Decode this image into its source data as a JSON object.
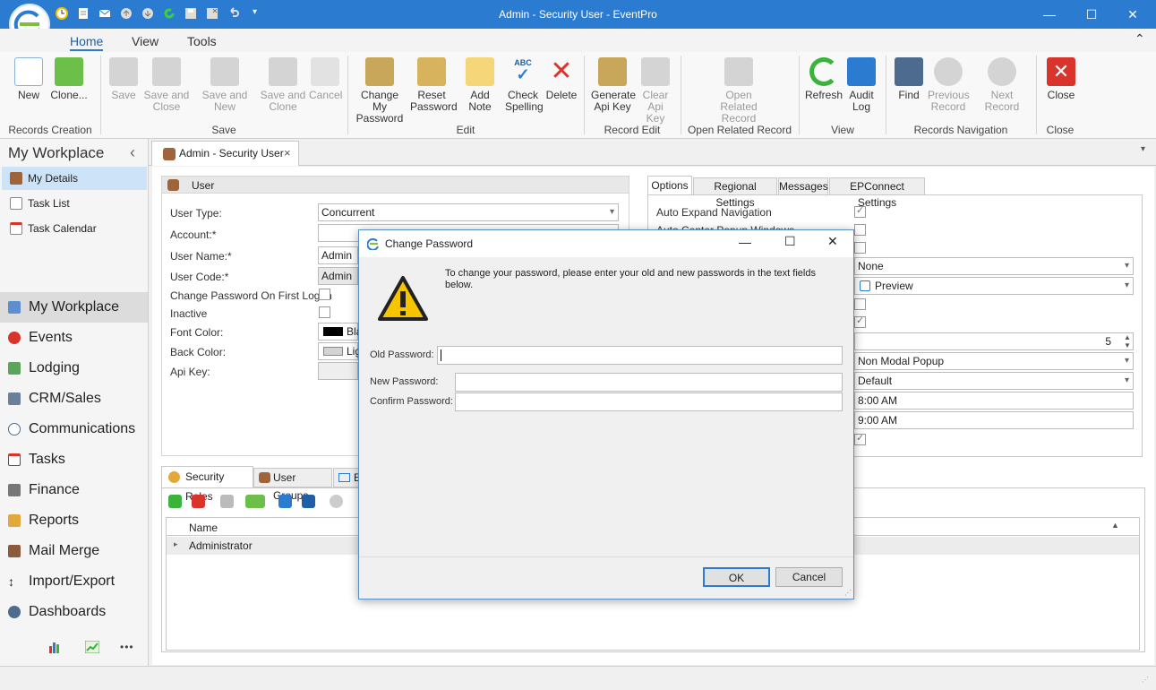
{
  "window": {
    "title": "Admin - Security User - EventPro",
    "minimize": "—",
    "maximize": "☐",
    "close": "✕"
  },
  "ribbon_tabs": [
    "Home",
    "View",
    "Tools"
  ],
  "ribbon": {
    "groups": [
      "Records Creation",
      "Save",
      "Edit",
      "Record Edit",
      "Open Related Record",
      "View",
      "Records Navigation",
      "Close"
    ],
    "buttons": {
      "new": "New",
      "clone": "Clone...",
      "save": "Save",
      "save_close_1": "Save and",
      "save_close_2": "Close",
      "save_new": "Save and New",
      "save_clone_1": "Save and",
      "save_clone_2": "Clone",
      "cancel": "Cancel",
      "change_pw_1": "Change My",
      "change_pw_2": "Password",
      "reset_pw_1": "Reset",
      "reset_pw_2": "Password",
      "add_note": "Add Note",
      "check_1": "Check",
      "check_2": "Spelling",
      "check_abc": "ABC",
      "delete": "Delete",
      "gen_api_1": "Generate",
      "gen_api_2": "Api Key",
      "clear_api_1": "Clear",
      "clear_api_2": "Api Key",
      "open_rel_1": "Open Related",
      "open_rel_2": "Record",
      "refresh": "Refresh",
      "audit_1": "Audit",
      "audit_2": "Log",
      "find": "Find",
      "prev_1": "Previous",
      "prev_2": "Record",
      "next": "Next Record",
      "close": "Close"
    }
  },
  "nav": {
    "header": "My Workplace",
    "collapse": "‹",
    "small_items": [
      "My Details",
      "Task List",
      "Task Calendar"
    ],
    "big_items": [
      "My Workplace",
      "Events",
      "Lodging",
      "CRM/Sales",
      "Communications",
      "Tasks",
      "Finance",
      "Reports",
      "Mail Merge",
      "Import/Export",
      "Dashboards"
    ],
    "more": "•••"
  },
  "doc_tab": {
    "label": "Admin - Security User",
    "close": "×"
  },
  "user_section": {
    "header": "User",
    "fields": {
      "user_type_label": "User Type:",
      "user_type": "Concurrent",
      "account_label": "Account:*",
      "user_name_label": "User Name:*",
      "user_name": "Admin",
      "user_code_label": "User Code:*",
      "user_code": "Admin",
      "change_pw_label": "Change Password On First Logon",
      "inactive_label": "Inactive",
      "font_color_label": "Font Color:",
      "font_color": "Bla",
      "back_color_label": "Back Color:",
      "back_color": "Lig",
      "api_key_label": "Api Key:"
    }
  },
  "options": {
    "tabs": [
      "Options",
      "Regional Settings",
      "Messages",
      "EPConnect Settings"
    ],
    "auto_expand": "Auto Expand Navigation",
    "auto_center": "Auto Center Popup Windows",
    "none": "None",
    "preview": "Preview",
    "spin_value": "5",
    "popup": "Non Modal Popup",
    "default": "Default",
    "time1": "8:00 AM",
    "time2": "9:00 AM"
  },
  "bottom": {
    "tabs": [
      "Security Roles",
      "User Groups",
      "E"
    ],
    "grid_col": "Name",
    "rows": [
      "Administrator"
    ]
  },
  "dialog": {
    "title": "Change Password",
    "message": "To change your password, please enter your old and new passwords in the text fields below.",
    "old_label": "Old Password:",
    "new_label": "New Password:",
    "confirm_label": "Confirm Password:",
    "ok": "OK",
    "cancel": "Cancel"
  }
}
